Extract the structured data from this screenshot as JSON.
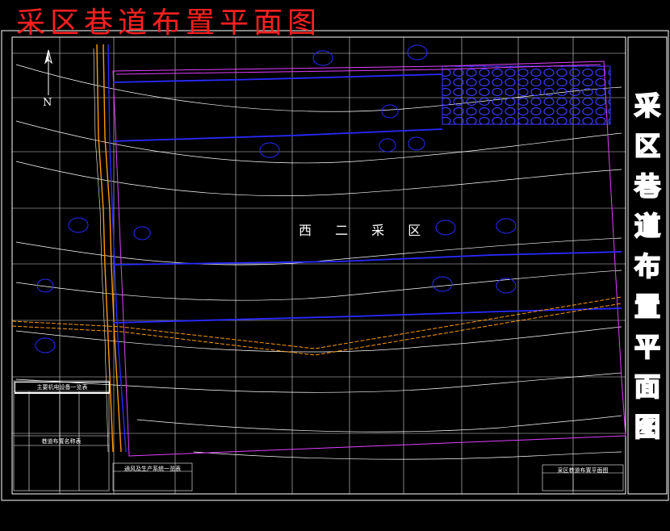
{
  "title_top": "采区巷道布置平面图",
  "title_side": [
    "采",
    "区",
    "巷",
    "道",
    "布",
    "置",
    "平",
    "面",
    "图"
  ],
  "area_name": "西 二 采 区",
  "north_label": "N",
  "colors": {
    "background": "#000000",
    "grid": "#ffffff",
    "roadway": "#2a2aff",
    "incline": "#ff9900",
    "boundary": "#e040ff",
    "title_red": "#ff2020",
    "goaf": "#2a2aff"
  },
  "tables": {
    "equipment": {
      "title": "主要机电设备一览表"
    },
    "roadways": {
      "title": "巷道布置名称表"
    },
    "ventilation": {
      "title": "通风及生产系统一览表"
    },
    "title_block": {
      "title": "采区巷道布置平面图"
    }
  }
}
